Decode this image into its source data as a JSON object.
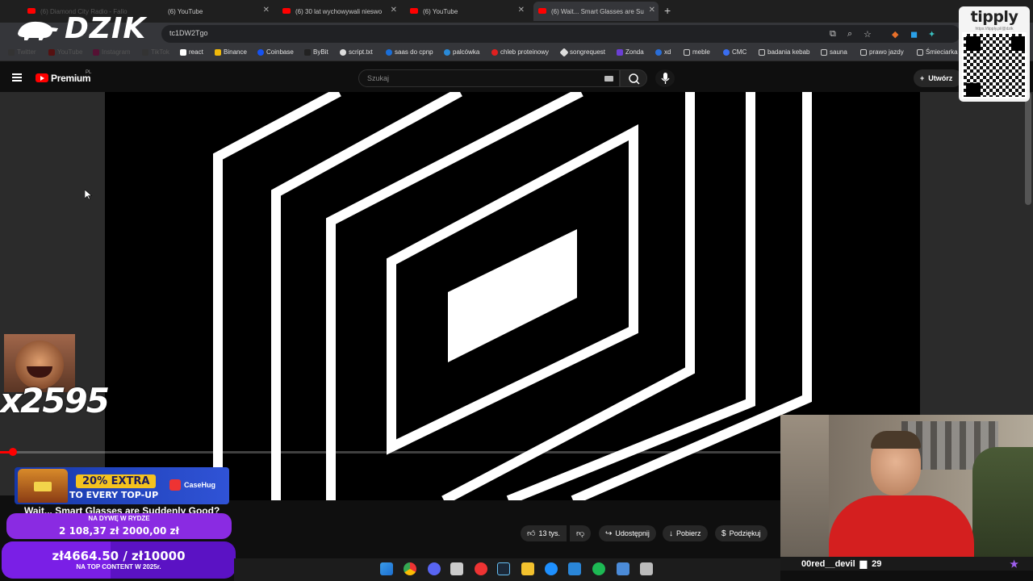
{
  "browser": {
    "tabs": [
      {
        "label": "(6) Diamond City Radio - Fallo"
      },
      {
        "label": "(6) YouTube"
      },
      {
        "label": "(6) 30 lat wychowywali nieswo"
      },
      {
        "label": "(6) YouTube"
      },
      {
        "label": "(6) Wait... Smart Glasses are Su"
      }
    ],
    "url": "tc1DW2Tgo",
    "bookmarks": [
      "Twitter",
      "YouTube",
      "Instagram",
      "TikTok",
      "react",
      "Binance",
      "Coinbase",
      "ByBit",
      "script.txt",
      "saas do cpnp",
      "palcówka",
      "chleb proteinowy",
      "songrequest",
      "Zonda",
      "xd",
      "meble",
      "CMC",
      "badania kebab",
      "sauna",
      "prawo jazdy",
      "Śmieciarka"
    ]
  },
  "logo": {
    "text": "DZIK"
  },
  "youtube": {
    "brand": "Premium",
    "region": "PL",
    "search_placeholder": "Szukaj",
    "create_label": "Utwórz"
  },
  "video": {
    "title": "Wait... Smart Glasses are Suddenly Good?",
    "progress_percent": 1.5,
    "likes": "13 tys.",
    "share_label": "Udostępnij",
    "download_label": "Pobierz",
    "thanks_label": "Podziękuj"
  },
  "overlays": {
    "multiplier": "x2595",
    "promo_badge": "20% EXTRA",
    "promo_text": "TO EVERY TOP-UP",
    "promo_brand": "CaseHug",
    "goal1_label": "NA DYWĘ W RYDZE",
    "goal1_amount": "2 108,37 zł   2000,00 zł",
    "goal2_amount": "zł4664.50 / zł10000",
    "goal2_label": "NA TOP CONTENT W 2025r.",
    "goal2_progress_percent": 46.6,
    "tipply_title": "tipply",
    "tipply_url": "https://tipply.pl/@dzik"
  },
  "webcam": {
    "username": "00red__devil",
    "count": "29"
  },
  "colors": {
    "accent_red": "#ff0000",
    "goal_purple": "#8a2be2",
    "promo_blue": "#2b48c8",
    "promo_yellow": "#f4c21e"
  }
}
